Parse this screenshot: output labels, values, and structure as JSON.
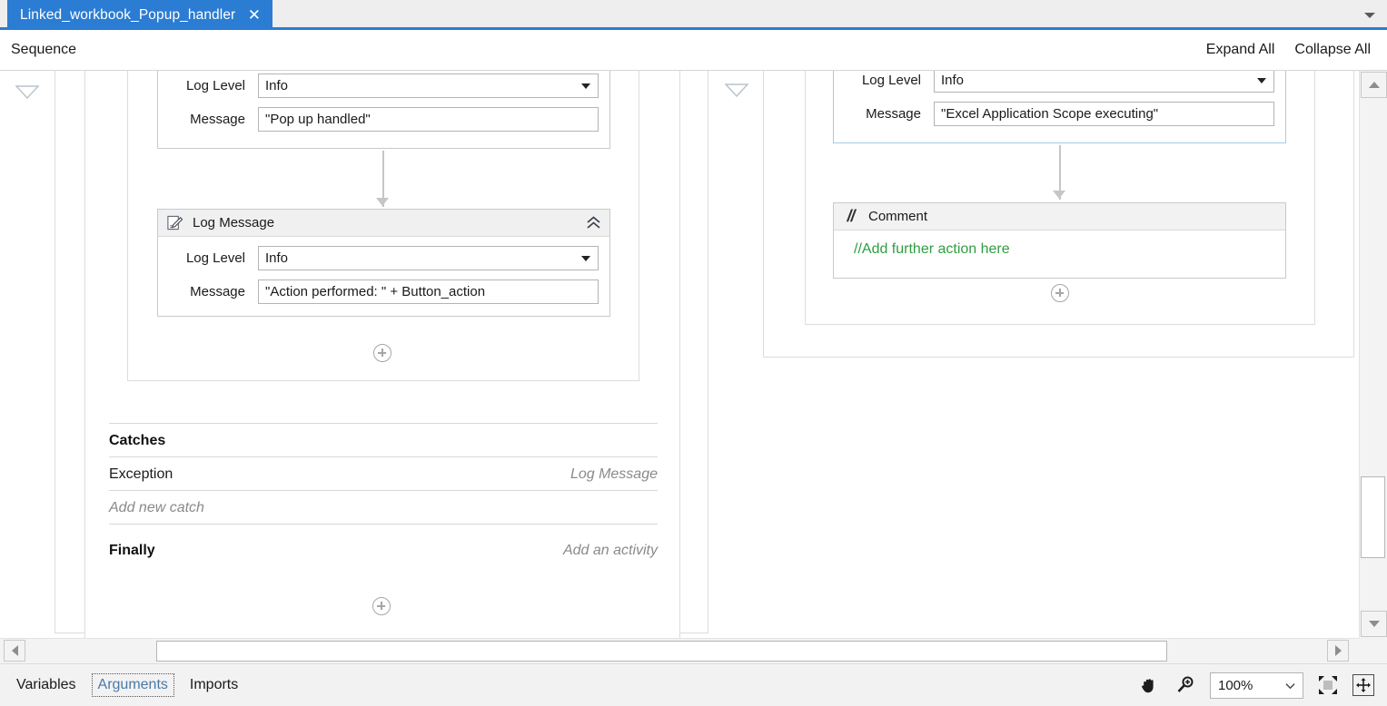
{
  "tab": {
    "title": "Linked_workbook_Popup_handler",
    "close_icon": "close-icon",
    "menu_icon": "chevron-down-icon"
  },
  "command_bar": {
    "breadcrumb": "Sequence",
    "expand_all": "Expand All",
    "collapse_all": "Collapse All"
  },
  "canvas": {
    "left_sequence": {
      "log_message_top": {
        "log_level_label": "Log Level",
        "log_level_value": "Info",
        "message_label": "Message",
        "message_value": "\"Pop up handled\""
      },
      "log_message_second": {
        "title": "Log Message",
        "icon": "log-message-icon",
        "collapse_icon": "chevron-double-up-icon",
        "log_level_label": "Log Level",
        "log_level_value": "Info",
        "message_label": "Message",
        "message_value": "\"Action performed: \" + Button_action"
      },
      "try_catch": {
        "catches_label": "Catches",
        "exception_type": "Exception",
        "exception_activity": "Log Message",
        "add_new_catch": "Add new catch",
        "finally_label": "Finally",
        "finally_placeholder": "Add an activity"
      }
    },
    "right_sequence": {
      "log_message": {
        "log_level_label": "Log Level",
        "log_level_value": "Info",
        "message_label": "Message",
        "message_value": "\"Excel Application Scope executing\""
      },
      "comment": {
        "title": "Comment",
        "icon": "comment-icon",
        "text": "//Add further action here"
      }
    }
  },
  "status_bar": {
    "tabs": [
      "Variables",
      "Arguments",
      "Imports"
    ],
    "focused_tab": "Arguments",
    "pan_icon": "hand-pan-icon",
    "zoom_icon": "magnifier-zoom-icon",
    "zoom_value": "100%",
    "fit_icon": "fit-to-screen-icon",
    "overview_icon": "overview-icon"
  },
  "colors": {
    "accent": "#2b7cd3",
    "comment_green": "#2f9e41",
    "selected_border": "#a8cbe3",
    "muted_text": "#8a8a8a"
  }
}
